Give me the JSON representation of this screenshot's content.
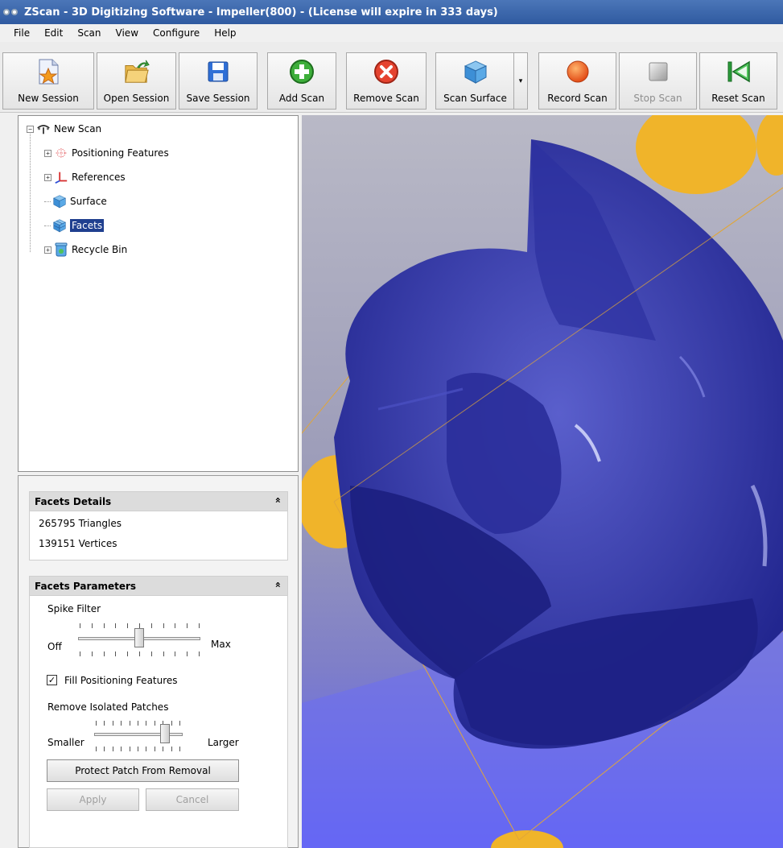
{
  "window": {
    "title": "ZScan - 3D Digitizing Software - Impeller(800) - (License will expire in 333 days)"
  },
  "menu": [
    "File",
    "Edit",
    "Scan",
    "View",
    "Configure",
    "Help"
  ],
  "toolbar": {
    "new_session": "New Session",
    "open_session": "Open Session",
    "save_session": "Save Session",
    "add_scan": "Add Scan",
    "remove_scan": "Remove Scan",
    "scan_surface": "Scan Surface",
    "dropdown_arrow": "▾",
    "record_scan": "Record Scan",
    "stop_scan": "Stop Scan",
    "reset_scan": "Reset Scan"
  },
  "tree": {
    "root": "New Scan",
    "items": [
      {
        "label": "Positioning Features",
        "expandable": true
      },
      {
        "label": "References",
        "expandable": true
      },
      {
        "label": "Surface",
        "expandable": false
      },
      {
        "label": "Facets",
        "expandable": false,
        "selected": true
      },
      {
        "label": "Recycle Bin",
        "expandable": true
      }
    ],
    "expand_glyph": "+",
    "collapse_glyph": "−"
  },
  "facets_details": {
    "title": "Facets Details",
    "collapse_glyph": "»",
    "triangles": "265795 Triangles",
    "vertices": "139151 Vertices"
  },
  "facets_parameters": {
    "title": "Facets Parameters",
    "collapse_glyph": "»",
    "spike_filter": {
      "label": "Spike Filter",
      "min_label": "Off",
      "max_label": "Max",
      "value": 0.5
    },
    "fill_positioning": {
      "label": "Fill Positioning Features",
      "checked": true,
      "mark": "✓"
    },
    "remove_isolated": {
      "label": "Remove Isolated Patches",
      "min_label": "Smaller",
      "max_label": "Larger",
      "value": 0.8
    },
    "protect_button": "Protect Patch From Removal",
    "apply_button": "Apply",
    "cancel_button": "Cancel"
  },
  "colors": {
    "mesh": "#22268f",
    "mesh_highlight": "#5a5fcc",
    "target": "#f0b42a",
    "guide_line": "#e0a63a",
    "background_top": "#b9b9c6",
    "background_bottom": "#5d5ff5",
    "selection": "#1f3f8f"
  }
}
